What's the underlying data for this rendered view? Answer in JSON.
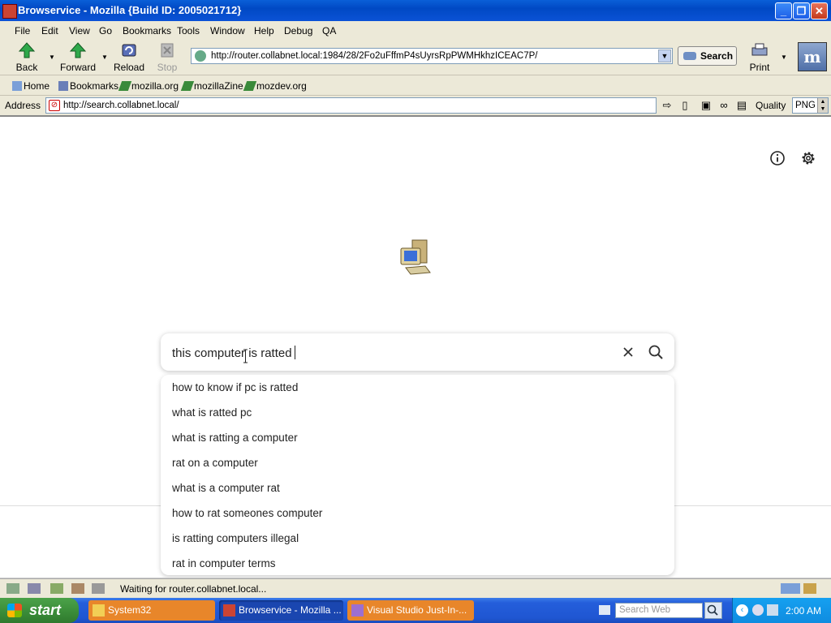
{
  "window": {
    "title": "Browservice - Mozilla {Build ID: 2005021712}"
  },
  "menu": [
    "File",
    "Edit",
    "View",
    "Go",
    "Bookmarks",
    "Tools",
    "Window",
    "Help",
    "Debug",
    "QA"
  ],
  "nav": {
    "back": "Back",
    "forward": "Forward",
    "reload": "Reload",
    "stop": "Stop",
    "url": "http://router.collabnet.local:1984/28/2Fo2uFffmP4sUyrsRpPWMHkhzICEAC7P/",
    "search": "Search",
    "print": "Print",
    "throbber": "m"
  },
  "personal": [
    "Home",
    "Bookmarks",
    "mozilla.org",
    "mozillaZine",
    "mozdev.org"
  ],
  "address": {
    "label": "Address",
    "url": "http://search.collabnet.local/",
    "quality_label": "Quality",
    "quality_value": "PNG"
  },
  "page": {
    "query": "this computer is ratted",
    "suggestions": [
      "how to know if pc is ratted",
      "what is ratted pc",
      "what is ratting a computer",
      "rat on a computer",
      "what is a computer rat",
      "how to rat someones computer",
      "is ratting computers illegal",
      "rat in computer terms"
    ],
    "icons": [
      "info-icon",
      "settings-icon",
      "computer-logo-icon",
      "clear-icon",
      "search-icon"
    ]
  },
  "status": {
    "text": "Waiting for router.collabnet.local..."
  },
  "taskbar": {
    "start": "start",
    "tasks": [
      "System32",
      "Browservice - Mozilla ...",
      "Visual Studio Just-In-..."
    ],
    "search_placeholder": "Search Web",
    "clock": "2:00 AM"
  },
  "colors": {
    "title_bar": "#0049c4",
    "taskbar": "#245edb",
    "start": "#3c8f3a",
    "tray": "#0f8ce0"
  }
}
